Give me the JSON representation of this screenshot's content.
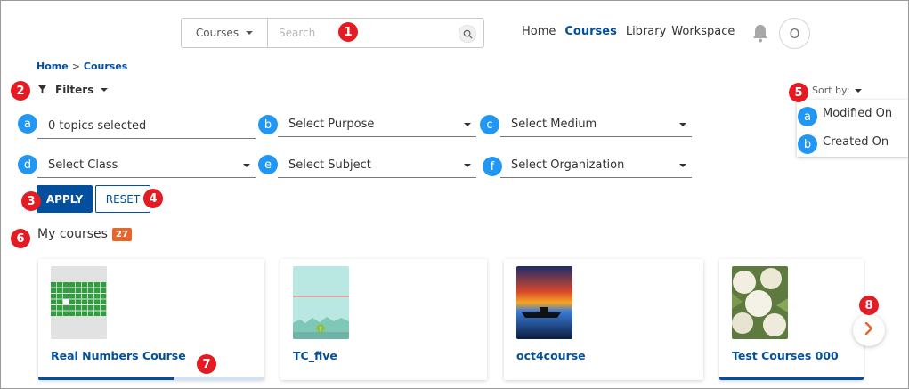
{
  "header": {
    "search_scope": "Courses",
    "search_placeholder": "Search",
    "nav": [
      "Home",
      "Courses",
      "Library",
      "Workspace"
    ],
    "active_nav": "Courses",
    "avatar_initial": "O"
  },
  "breadcrumb": {
    "home": "Home",
    "separator": ">",
    "current": "Courses"
  },
  "filters": {
    "toggle_label": "Filters",
    "topics": "0 topics selected",
    "purpose": "Select Purpose",
    "medium": "Select Medium",
    "class": "Select Class",
    "subject": "Select Subject",
    "organization": "Select Organization",
    "apply_label": "APPLY",
    "reset_label": "RESET"
  },
  "sort": {
    "label": "Sort by:",
    "options": [
      "Modified On",
      "Created On"
    ]
  },
  "courses_section": {
    "title": "My courses",
    "count": "27",
    "cards": [
      {
        "title": "Real Numbers Course",
        "progress": 0.6
      },
      {
        "title": "TC_five",
        "progress": 0
      },
      {
        "title": "oct4course",
        "progress": 0
      },
      {
        "title": "Test Courses 000",
        "progress": 1.0
      }
    ]
  },
  "annotations": {
    "red": [
      "1",
      "2",
      "3",
      "4",
      "5",
      "6",
      "7",
      "8"
    ],
    "blue": [
      "a",
      "b",
      "c",
      "d",
      "e",
      "f",
      "a",
      "b"
    ]
  },
  "colors": {
    "primary": "#024f9d",
    "badge_red": "#e31b23",
    "badge_blue": "#2196f3",
    "count_orange": "#e5662b",
    "next_arrow": "#e5662b"
  },
  "icons": {
    "search": "search-icon",
    "bell": "bell-icon",
    "filter": "filter-icon",
    "next": "chevron-right-icon"
  }
}
